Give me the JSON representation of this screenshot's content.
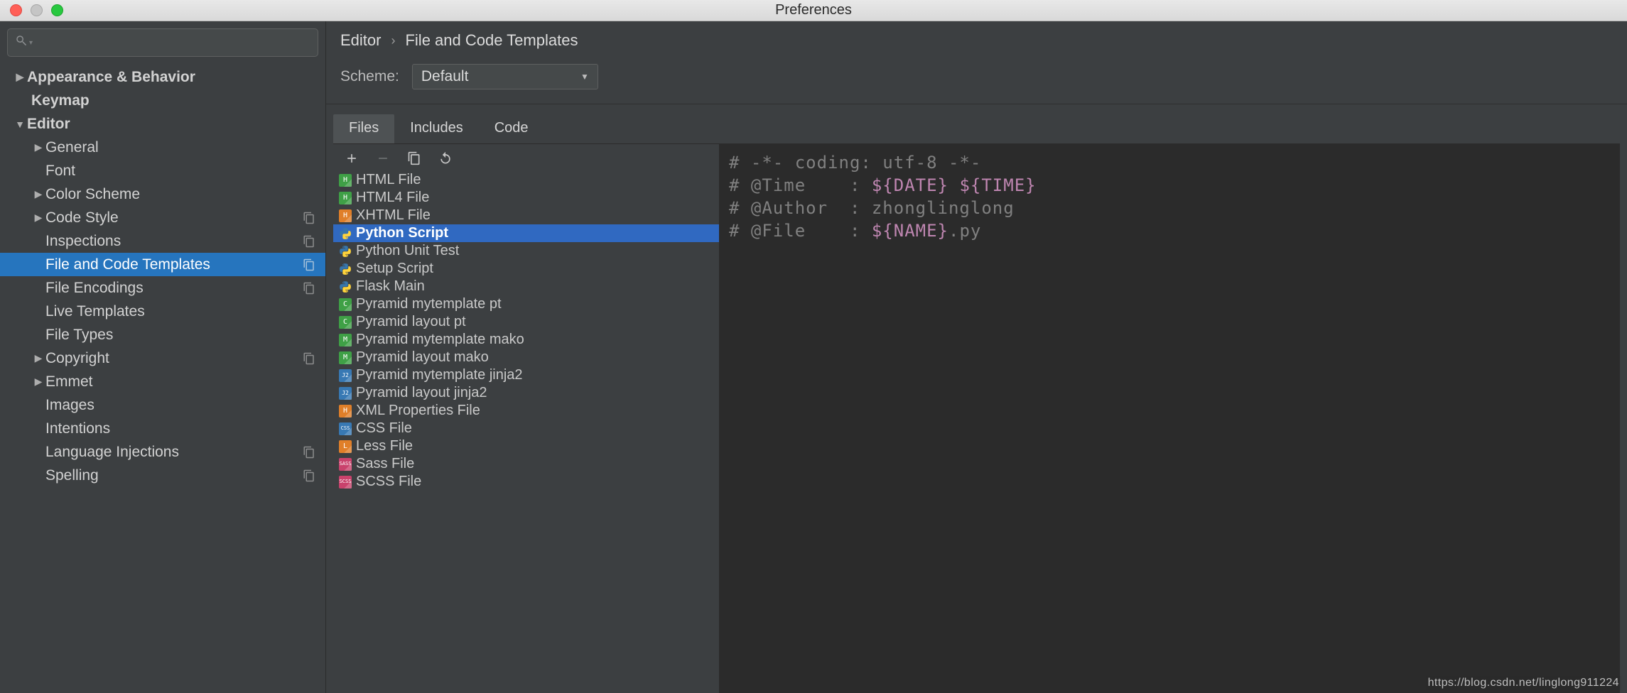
{
  "window": {
    "title": "Preferences"
  },
  "sidebar": {
    "search_placeholder": "",
    "items": {
      "appearance": {
        "label": "Appearance & Behavior"
      },
      "keymap": {
        "label": "Keymap"
      },
      "editor": {
        "label": "Editor"
      },
      "general": {
        "label": "General"
      },
      "font": {
        "label": "Font"
      },
      "color_scheme": {
        "label": "Color Scheme"
      },
      "code_style": {
        "label": "Code Style"
      },
      "inspections": {
        "label": "Inspections"
      },
      "file_and_code_templates": {
        "label": "File and Code Templates"
      },
      "file_encodings": {
        "label": "File Encodings"
      },
      "live_templates": {
        "label": "Live Templates"
      },
      "file_types": {
        "label": "File Types"
      },
      "copyright": {
        "label": "Copyright"
      },
      "emmet": {
        "label": "Emmet"
      },
      "images": {
        "label": "Images"
      },
      "intentions": {
        "label": "Intentions"
      },
      "language_injections": {
        "label": "Language Injections"
      },
      "spelling": {
        "label": "Spelling"
      }
    }
  },
  "breadcrumb": {
    "root": "Editor",
    "leaf": "File and Code Templates"
  },
  "scheme": {
    "label": "Scheme:",
    "value": "Default"
  },
  "tabs": {
    "files": "Files",
    "includes": "Includes",
    "code": "Code"
  },
  "templates": [
    {
      "icon": "h",
      "color": "ic-hg",
      "label": "HTML File"
    },
    {
      "icon": "h",
      "color": "ic-hg",
      "label": "HTML4 File"
    },
    {
      "icon": "h",
      "color": "ic-h",
      "label": "XHTML File"
    },
    {
      "icon": "py",
      "color": "py",
      "label": "Python Script",
      "selected": true
    },
    {
      "icon": "py",
      "color": "py",
      "label": "Python Unit Test"
    },
    {
      "icon": "py",
      "color": "py",
      "label": "Setup Script"
    },
    {
      "icon": "py",
      "color": "py",
      "label": "Flask Main"
    },
    {
      "icon": "c",
      "color": "ic-c",
      "label": "Pyramid mytemplate pt"
    },
    {
      "icon": "c",
      "color": "ic-c",
      "label": "Pyramid layout pt"
    },
    {
      "icon": "m",
      "color": "ic-m",
      "label": "Pyramid mytemplate mako"
    },
    {
      "icon": "m",
      "color": "ic-m",
      "label": "Pyramid layout mako"
    },
    {
      "icon": "j2",
      "color": "ic-j2",
      "label": "Pyramid mytemplate jinja2"
    },
    {
      "icon": "j2",
      "color": "ic-j2",
      "label": "Pyramid layout jinja2"
    },
    {
      "icon": "h",
      "color": "ic-h",
      "label": "XML Properties File"
    },
    {
      "icon": "css",
      "color": "ic-css",
      "label": "CSS File"
    },
    {
      "icon": "l",
      "color": "ic-l",
      "label": "Less File"
    },
    {
      "icon": "sass",
      "color": "ic-sass",
      "label": "Sass File"
    },
    {
      "icon": "scss",
      "color": "ic-scss",
      "label": "SCSS File"
    }
  ],
  "editor": {
    "line1_a": "# -*- coding: utf-8 -*-",
    "line2_a": "# @Time    : ",
    "line2_b": "${DATE}",
    "line2_c": " ",
    "line2_d": "${TIME}",
    "line3_a": "# @Author  : zhonglinglong",
    "line4_a": "# @File    : ",
    "line4_b": "${NAME}",
    "line4_c": ".py"
  },
  "watermark": "https://blog.csdn.net/linglong911224"
}
